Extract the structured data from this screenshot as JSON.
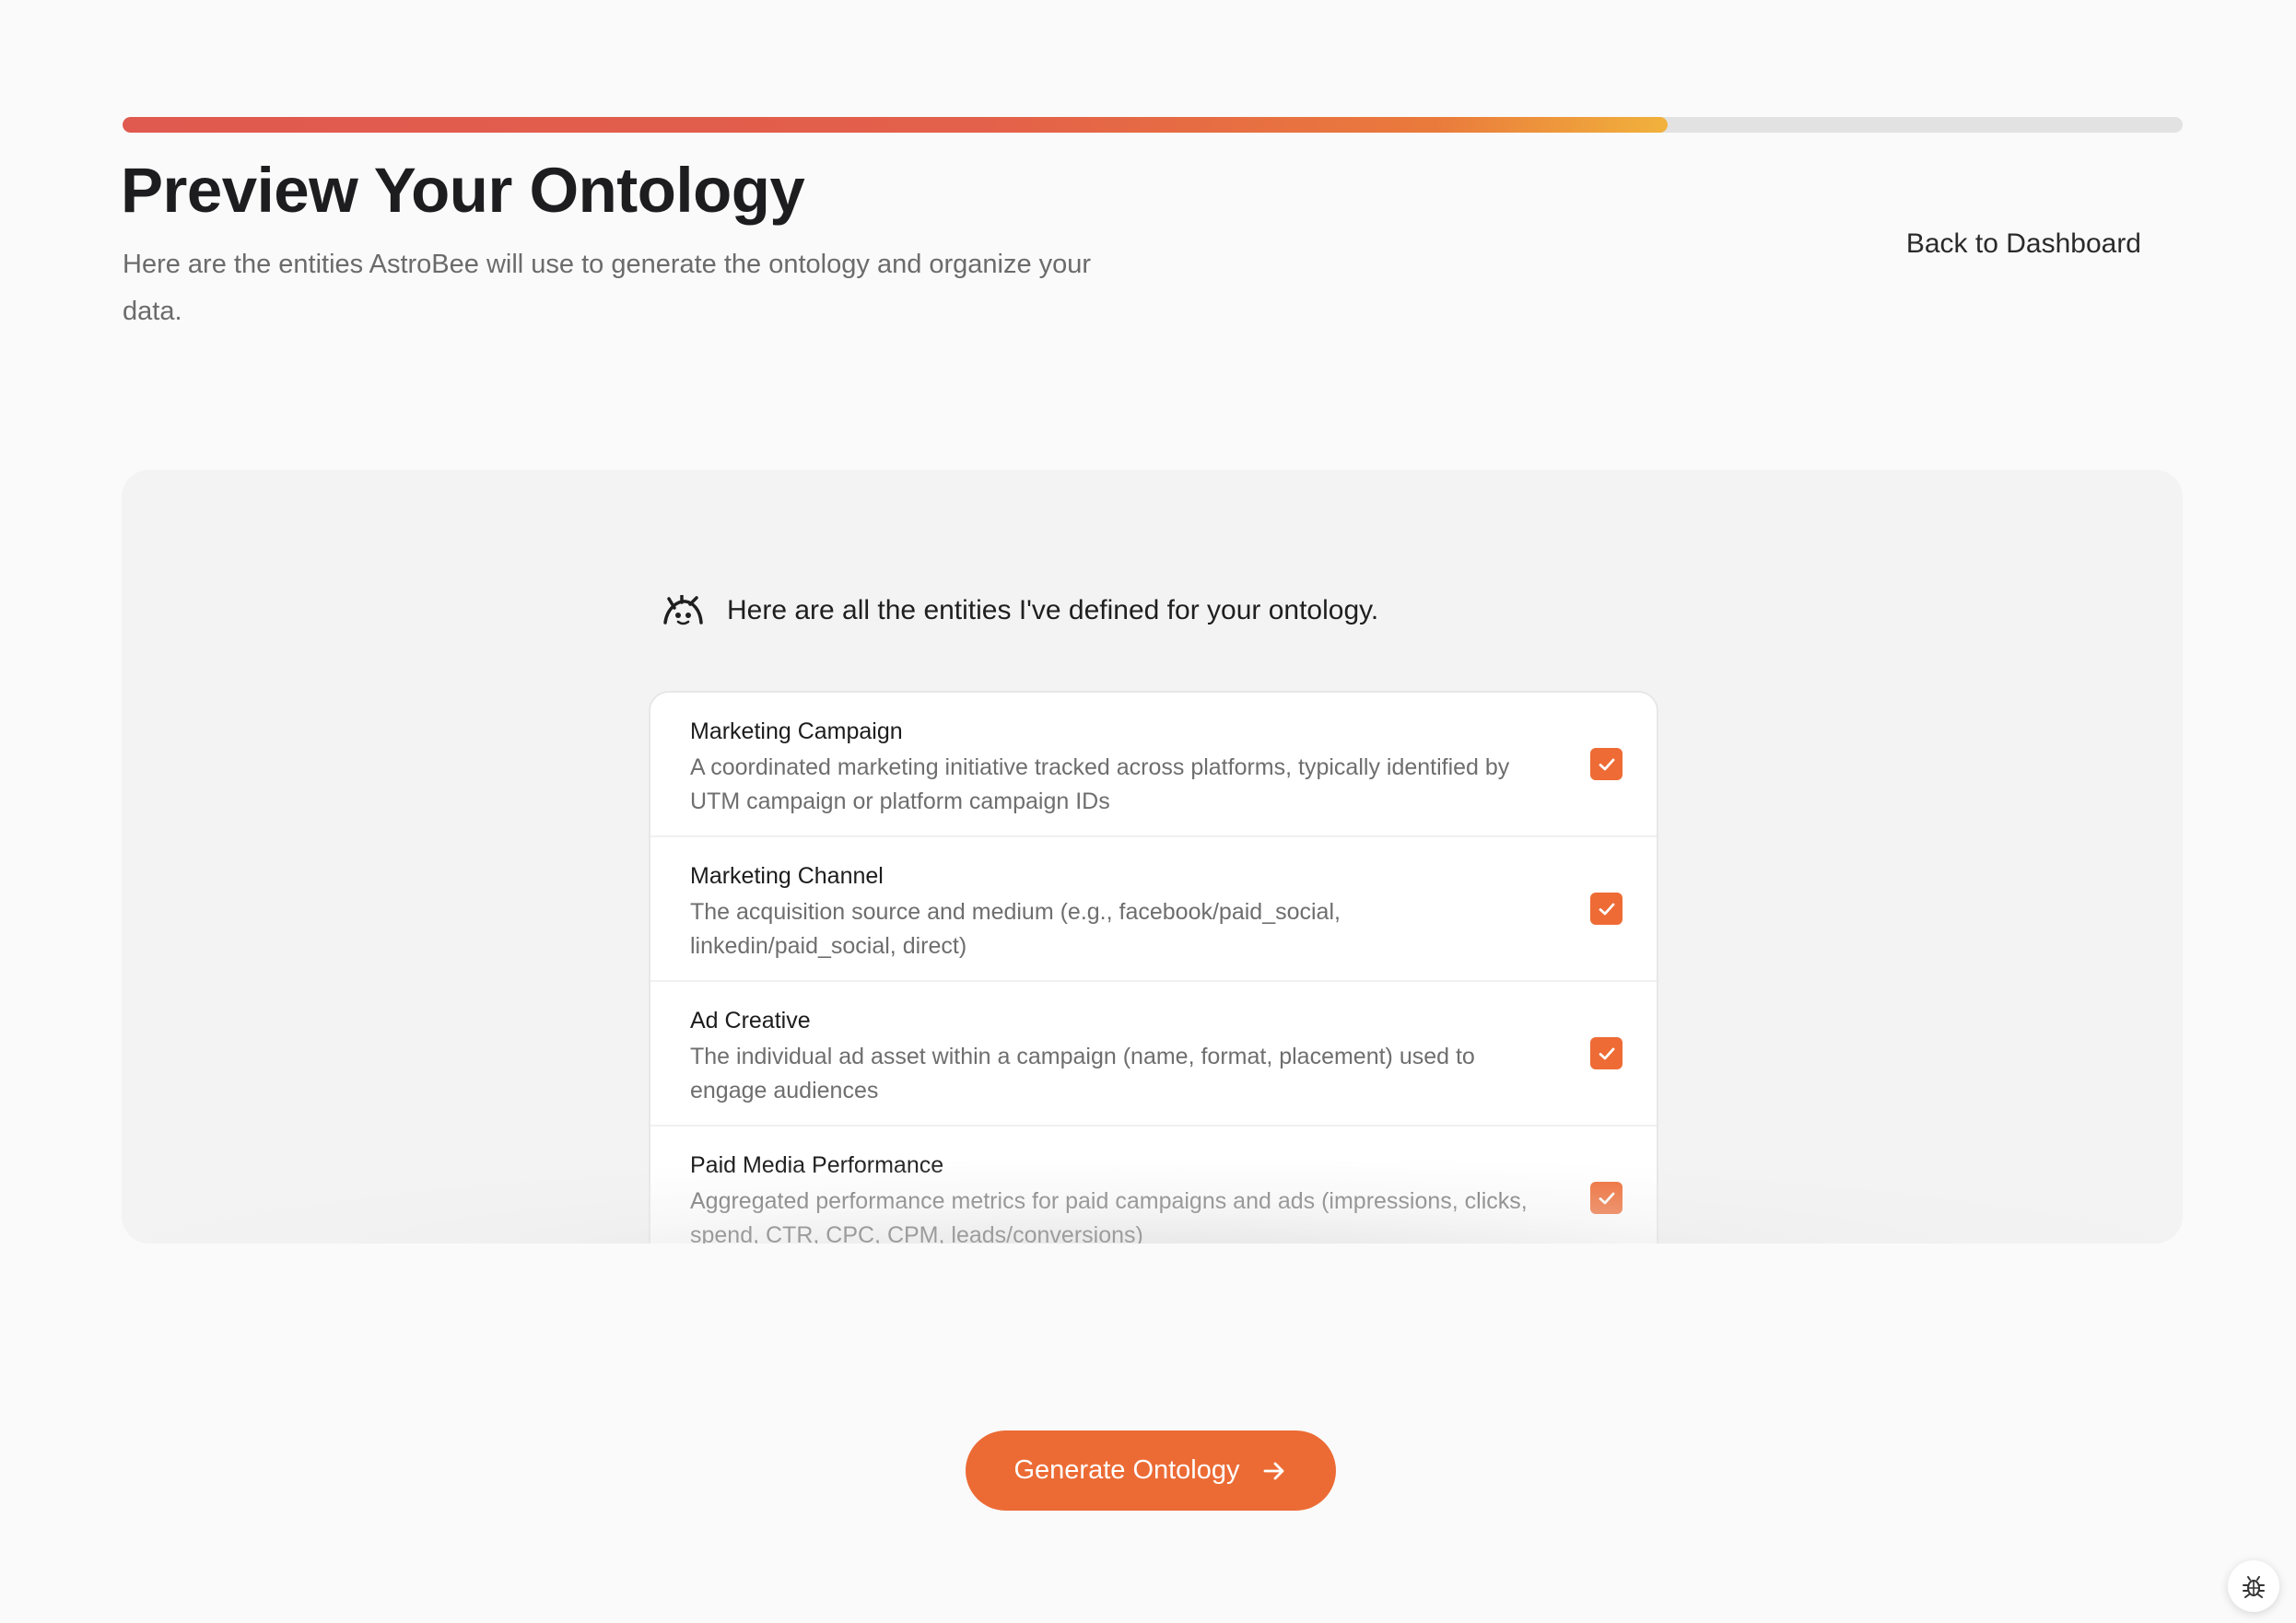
{
  "progress": {
    "percent": 75
  },
  "header": {
    "title": "Preview Your Ontology",
    "subtitle": "Here are the entities AstroBee will use to generate the ontology and organize your data.",
    "back_label": "Back to Dashboard"
  },
  "assistant": {
    "icon": "astrobee-icon",
    "message": "Here are all the entities I've defined for your ontology."
  },
  "entities": [
    {
      "name": "Marketing Campaign",
      "description": "A coordinated marketing initiative tracked across platforms, typically identified by UTM campaign or platform campaign IDs",
      "checked": true
    },
    {
      "name": "Marketing Channel",
      "description": "The acquisition source and medium (e.g., facebook/paid_social, linkedin/paid_social, direct)",
      "checked": true
    },
    {
      "name": "Ad Creative",
      "description": "The individual ad asset within a campaign (name, format, placement) used to engage audiences",
      "checked": true
    },
    {
      "name": "Paid Media Performance",
      "description": "Aggregated performance metrics for paid campaigns and ads (impressions, clicks, spend, CTR, CPC, CPM, leads/conversions)",
      "checked": true
    }
  ],
  "footer": {
    "generate_label": "Generate Ontology",
    "generate_icon": "arrow-right-icon",
    "debug_icon": "bug-icon"
  },
  "colors": {
    "accent": "#ec6b35",
    "progress_start": "#e05a4f",
    "progress_end": "#f1b23c",
    "panel_bg": "#f3f3f3"
  }
}
